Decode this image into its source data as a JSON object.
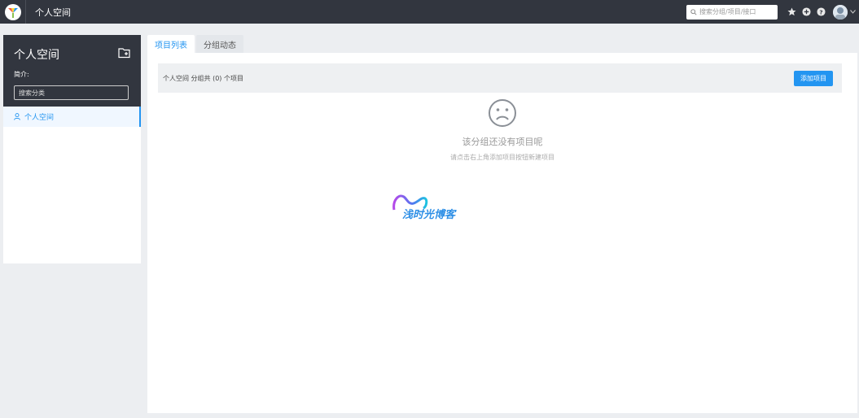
{
  "topbar": {
    "title": "个人空间",
    "search_placeholder": "搜索分组/项目/接口",
    "icons": [
      "star-icon",
      "plus-circle-icon",
      "help-icon"
    ]
  },
  "sidebar": {
    "title": "个人空间",
    "intro_label": "简介:",
    "search_placeholder": "搜索分类",
    "items": [
      {
        "label": "个人空间"
      }
    ]
  },
  "tabs": [
    {
      "label": "项目列表",
      "active": true
    },
    {
      "label": "分组动态",
      "active": false
    }
  ],
  "main": {
    "info_text": "个人空间 分组共 (0) 个项目",
    "add_button": "添加项目",
    "empty_title": "该分组还没有项目呢",
    "empty_desc": "请点击右上角添加项目按钮新建项目"
  },
  "watermark": {
    "text": "浅时光博客"
  },
  "colors": {
    "accent": "#2395f1",
    "topbar": "#32363f",
    "background": "#eceef1"
  }
}
